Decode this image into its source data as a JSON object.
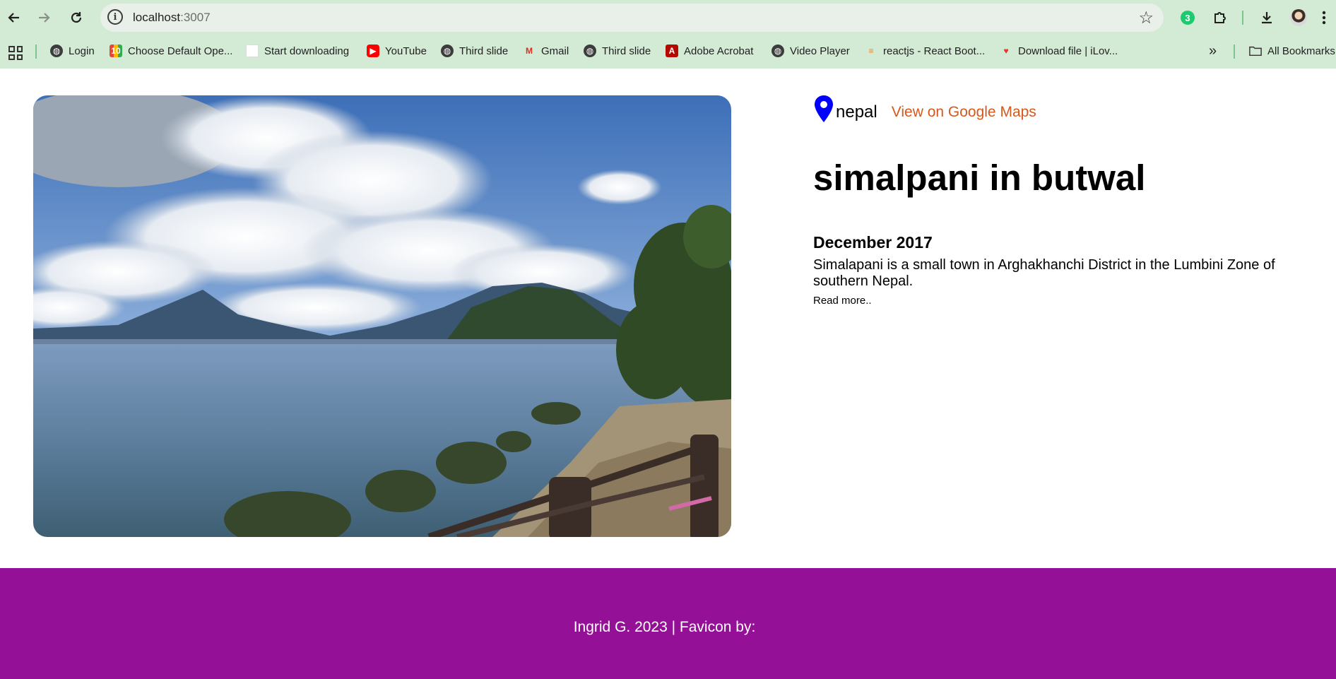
{
  "browser": {
    "url_host": "localhost",
    "url_port": ":3007",
    "extension_badge": "3",
    "bookmarks": [
      {
        "label": "Login",
        "icon": "globe-icon"
      },
      {
        "label": "Choose Default Ope...",
        "icon": "app-icon"
      },
      {
        "label": "Start downloading",
        "icon": "blank-page-icon"
      },
      {
        "label": "YouTube",
        "icon": "youtube-icon"
      },
      {
        "label": "Third slide",
        "icon": "globe-icon"
      },
      {
        "label": "Gmail",
        "icon": "gmail-icon"
      },
      {
        "label": "Third slide",
        "icon": "globe-icon"
      },
      {
        "label": "Adobe Acrobat",
        "icon": "pdf-icon"
      },
      {
        "label": "Video Player",
        "icon": "globe-icon"
      },
      {
        "label": "reactjs - React Boot...",
        "icon": "stackoverflow-icon"
      },
      {
        "label": "Download file | iLov...",
        "icon": "heart-icon"
      }
    ],
    "overflow_label": "»",
    "all_bookmarks_label": "All Bookmarks"
  },
  "place": {
    "country": "nepal",
    "maps_link": "View on Google Maps",
    "title": "simalpani in butwal",
    "date": "December 2017",
    "description": "Simalapani is a small town in Arghakhanchi District in the Lumbini Zone of southern Nepal.",
    "read_more": "Read more.."
  },
  "footer": {
    "text": "Ingrid G. 2023 | Favicon by:"
  },
  "colors": {
    "chrome_bg": "#d3ebd5",
    "pin": "#0000ff",
    "maps_link": "#d4591e",
    "footer_bg": "#941096"
  }
}
